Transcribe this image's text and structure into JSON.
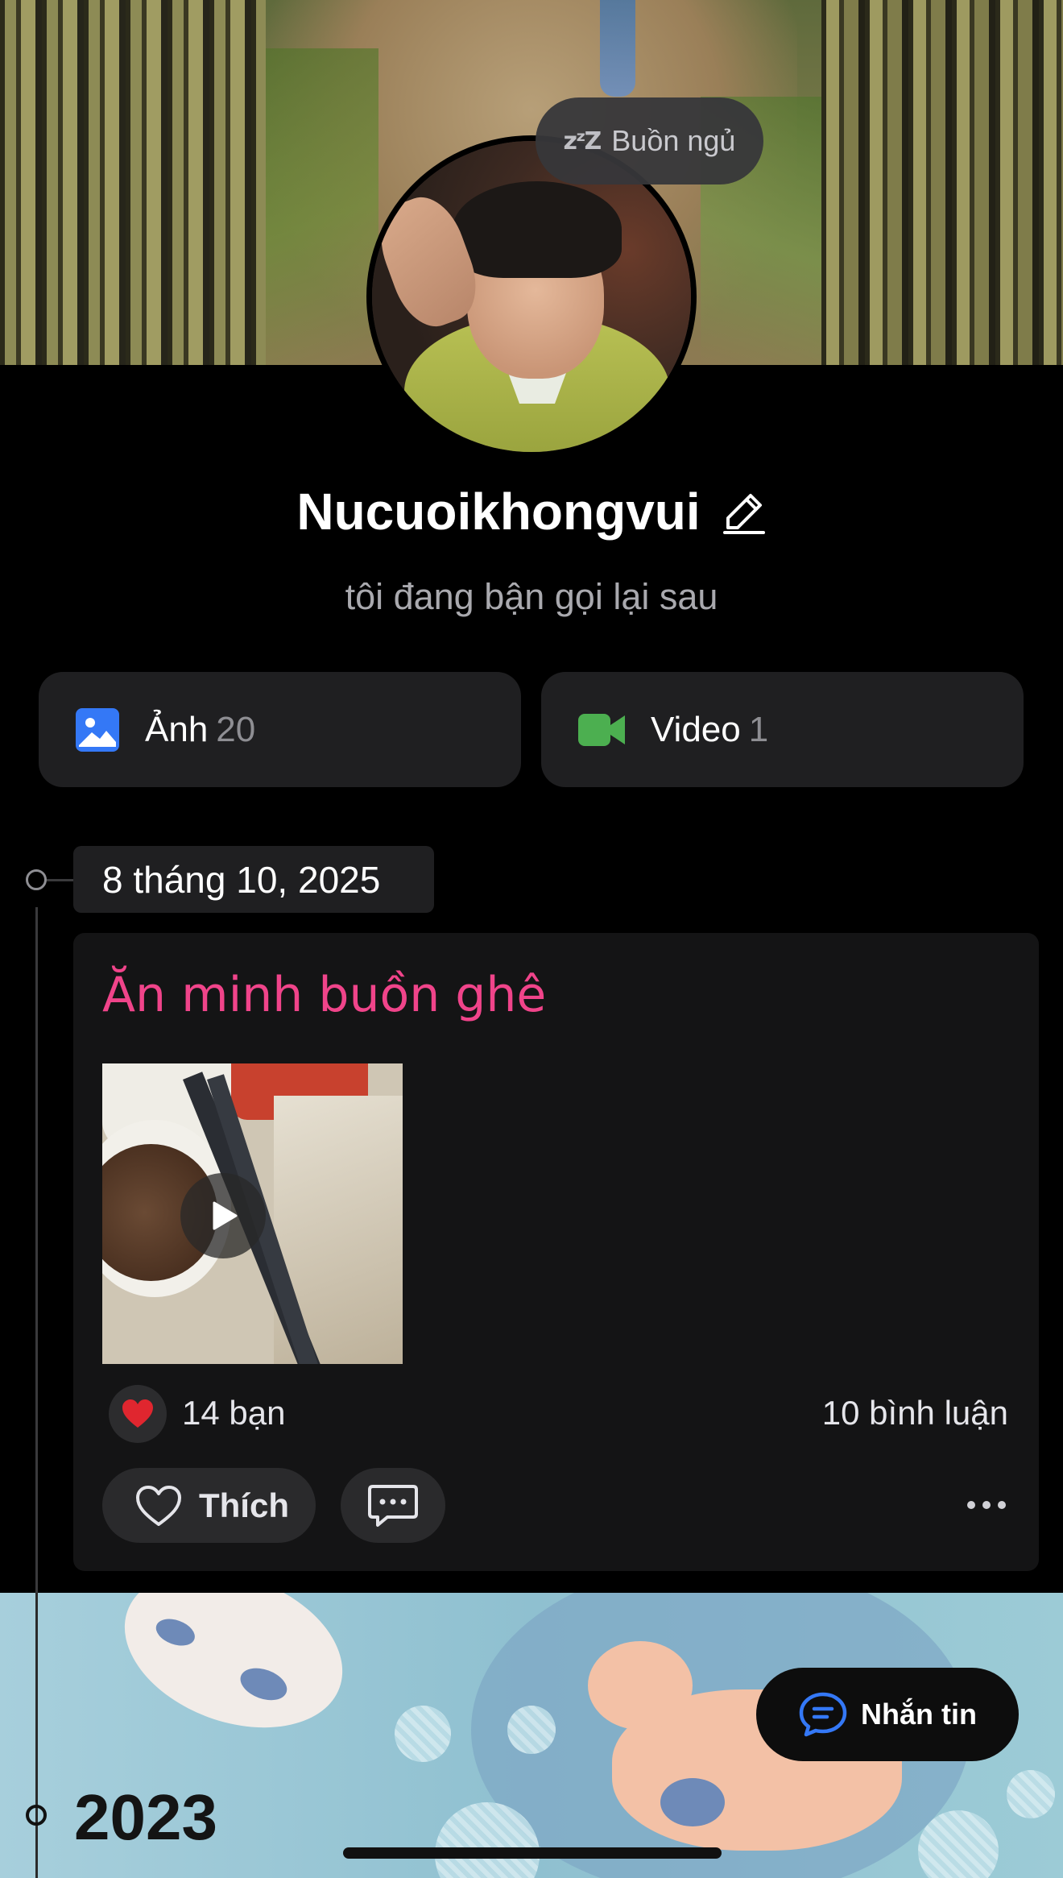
{
  "profile": {
    "status": "Buồn ngủ",
    "status_icon": "zzz-icon",
    "name": "Nucuoikhongvui",
    "bio": "tôi đang bận gọi lại sau"
  },
  "media": {
    "photos_label": "Ảnh",
    "photos_count": "20",
    "photos_icon_color": "#3478f6",
    "videos_label": "Video",
    "videos_count": "1",
    "videos_icon_color": "#4caf50"
  },
  "timeline": {
    "date": "8 tháng 10, 2025",
    "post": {
      "title": "Ăn minh buồn ghê",
      "title_color": "#f0448a",
      "media_type": "video",
      "reactions_label": "14 bạn",
      "comments_label": "10 bình luận",
      "like_label": "Thích"
    },
    "year": "2023"
  },
  "actions": {
    "message_label": "Nhắn tin"
  }
}
